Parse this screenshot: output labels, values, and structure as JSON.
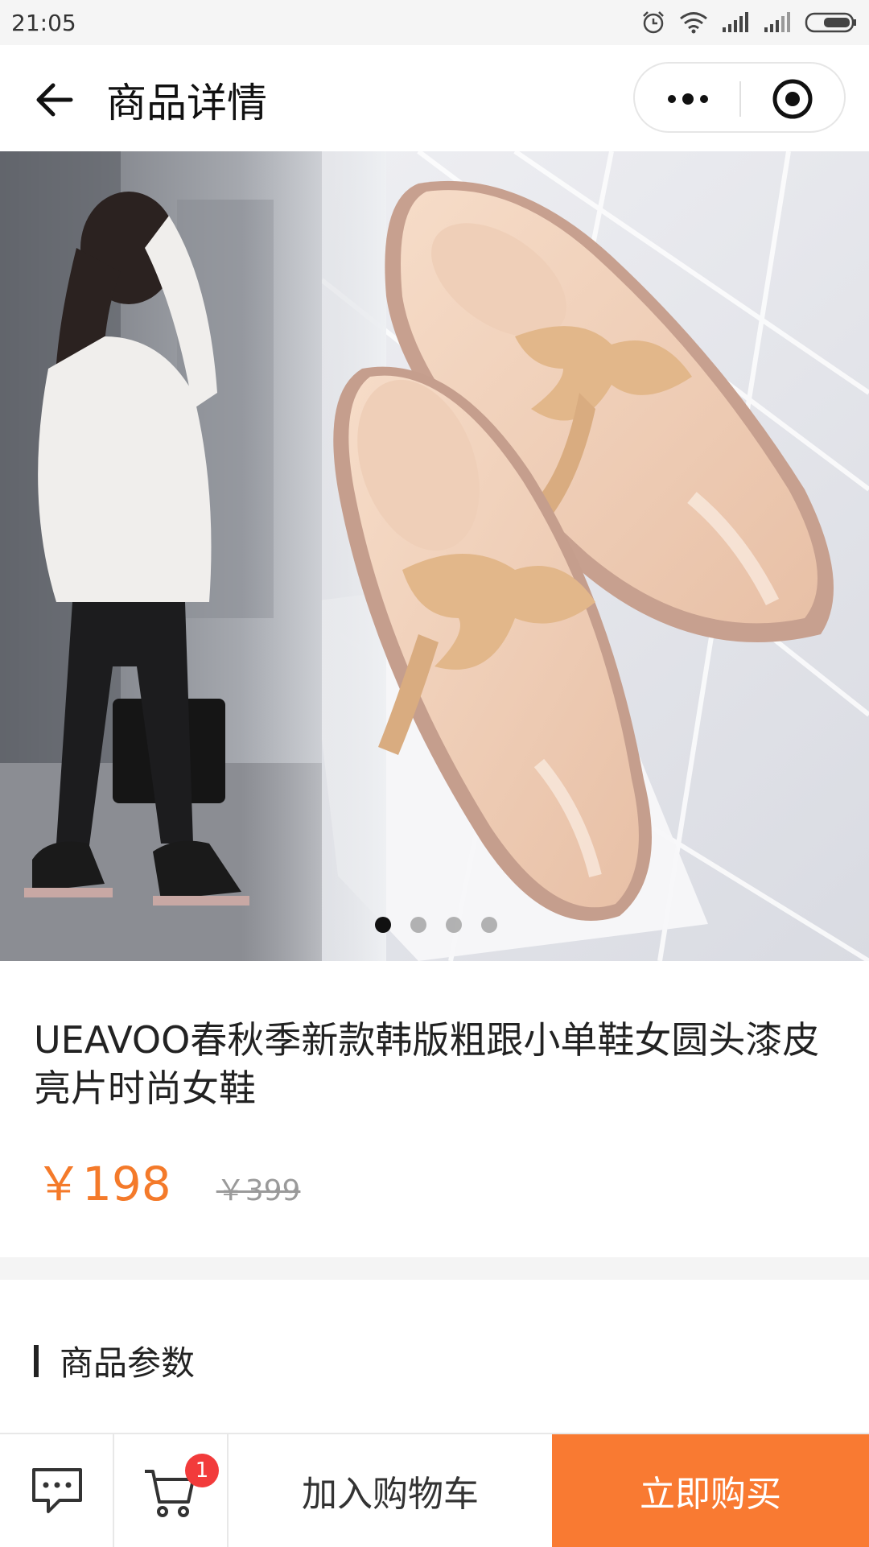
{
  "status": {
    "time": "21:05",
    "icons": [
      "alarm-icon",
      "wifi-icon",
      "signal-icon",
      "signal-icon",
      "battery-icon"
    ]
  },
  "nav": {
    "title": "商品详情",
    "back_icon": "arrow-left-icon",
    "more_icon": "more-dots-icon",
    "close_icon": "target-circle-icon"
  },
  "gallery": {
    "image_count": 4,
    "active_index": 0
  },
  "product": {
    "title": "UEAVOO春秋季新款韩版粗跟小单鞋女圆头漆皮亮片时尚女鞋",
    "price": "￥198",
    "original_price": "￥399",
    "price_color": "#f47a2a"
  },
  "params": {
    "section_title": "商品参数"
  },
  "bottom_bar": {
    "chat_icon": "chat-bubble-icon",
    "cart_icon": "cart-icon",
    "cart_badge": "1",
    "add_to_cart_label": "加入购物车",
    "buy_now_label": "立即购买",
    "buy_color": "#f97a32"
  }
}
